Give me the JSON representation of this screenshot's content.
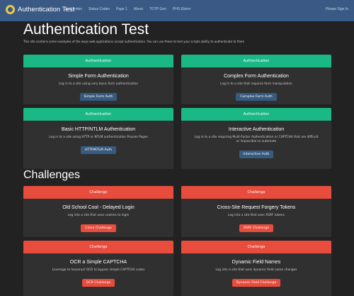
{
  "navbar": {
    "brand": "Authentication Test",
    "links": [
      "Auth Index",
      "Status Codes",
      "Page 1",
      "About",
      "TOTP Gen",
      "PHS Elsevr"
    ],
    "right": "Please Sign In"
  },
  "page": {
    "title": "Authentication Test",
    "intro": "This site contains some examples of the ways web applications accept authentication. You can use these to test your scripts ability to authenticate to them"
  },
  "auth_cards": [
    {
      "header": "Authentication",
      "title": "Simple Form Authentication",
      "text": "Log in to a site using very basic form authentication",
      "button": "Simple Form Auth"
    },
    {
      "header": "Authentication",
      "title": "Complex Form Authentication",
      "text": "Log in to a site that requires form manipulation",
      "button": "Complex Form Auth"
    },
    {
      "header": "Authentication",
      "title": "Basic HTTP/NTLM Authentication",
      "text": "Log in to a site using HTTP or NTLM authentication Proxies Pages",
      "button": "HTTP/NTLM Auth"
    },
    {
      "header": "Authentication",
      "title": "Interactive Authentication",
      "text": "Log in to a site requiring Multi-Factor Authentication or CAPTCHA that are difficult or impossible to automate",
      "button": "Interactive Auth"
    }
  ],
  "challenges": {
    "title": "Challenges",
    "cards": [
      {
        "header": "Challenge",
        "title": "Old School Cool - Delayed Login",
        "text": "Log into a site that uses cookies to login",
        "button": "Clone Challenge"
      },
      {
        "header": "Challenge",
        "title": "Cross-Site Request Forgery Tokens",
        "text": "Log into a site that uses XSRF tokens",
        "button": "XSRF Challenge"
      },
      {
        "header": "Challenge",
        "title": "OCR a Simple CAPTCHA",
        "text": "Leverage to tesseract OCR to bypass simple CAPTCHA codes",
        "button": "OCR Challenge"
      },
      {
        "header": "Challenge",
        "title": "Dynamic Field Names",
        "text": "Log into a site that uses dynamic field name changes",
        "button": "Dynamic Field Challenge"
      }
    ]
  },
  "colors": {
    "navbar": "#3a5a85",
    "background": "#222222",
    "card": "#303030",
    "auth_header": "#1ab884",
    "challenge_header": "#e74c3c",
    "auth_button": "#375a7f",
    "challenge_button": "#e74c3c"
  },
  "icons": {
    "logo": "brand-logo-icon"
  }
}
